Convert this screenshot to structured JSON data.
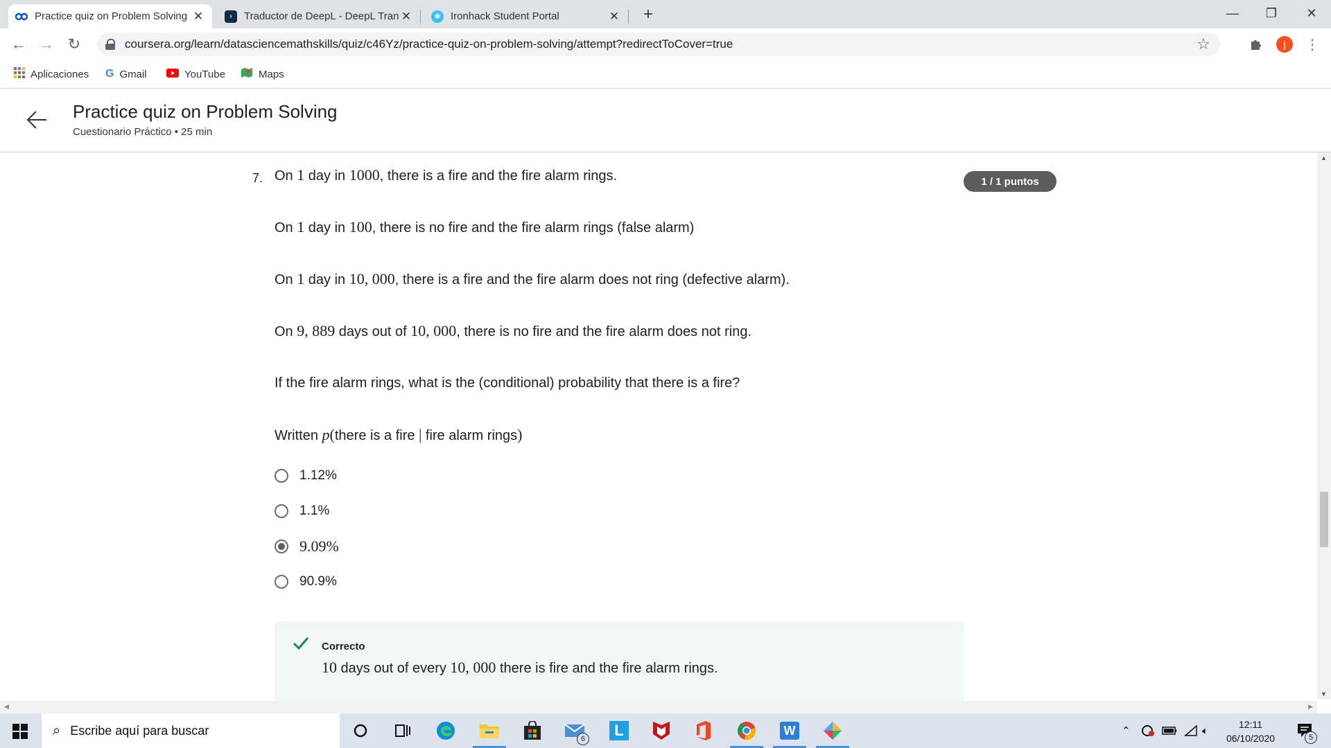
{
  "browser": {
    "tabs": [
      {
        "title": "Practice quiz on Problem Solving",
        "favicon": "coursera-icon",
        "active": true
      },
      {
        "title": "Traductor de DeepL - DeepL Tran",
        "favicon": "deepl-icon",
        "active": false
      },
      {
        "title": "Ironhack Student Portal",
        "favicon": "ironhack-icon",
        "active": false
      }
    ],
    "new_tab": "+",
    "url": "coursera.org/learn/datasciencemathskills/quiz/c46Yz/practice-quiz-on-problem-solving/attempt?redirectToCover=true",
    "profile_initial": "j",
    "bookmarks": [
      {
        "label": "Aplicaciones",
        "icon": "apps-grid-icon"
      },
      {
        "label": "Gmail",
        "icon": "google-icon"
      },
      {
        "label": "YouTube",
        "icon": "youtube-icon"
      },
      {
        "label": "Maps",
        "icon": "maps-icon"
      }
    ]
  },
  "quiz": {
    "title": "Practice quiz on Problem Solving",
    "subtitle": "Cuestionario Práctico • 25 min",
    "question_number": "7.",
    "score_badge": "1 / 1 puntos",
    "paragraphs": {
      "p1": {
        "a": "On ",
        "b": "1",
        "c": " day in ",
        "d": "1000",
        "e": ", there is a fire and the fire alarm rings."
      },
      "p2": {
        "a": "On ",
        "b": "1",
        "c": " day in ",
        "d": "100",
        "e": ", there is no fire and the fire alarm rings (false alarm)"
      },
      "p3": {
        "a": "On ",
        "b": "1",
        "c": " day in ",
        "d": "10, 000",
        "e": ", there is a fire and the fire alarm does not ring (defective alarm)."
      },
      "p4": {
        "a": "On ",
        "b": "9, 889",
        "c": " days out of ",
        "d": "10, 000",
        "e": ", there is no fire and the fire alarm does not ring."
      },
      "p5": {
        "a": "If the fire alarm rings, what is the (conditional) probability that there is a fire?"
      },
      "p6": {
        "a": "Written ",
        "b": "p",
        "c": "(",
        "d": "there is a fire",
        "e": " | ",
        "f": "fire alarm rings",
        "g": ")"
      }
    },
    "options": [
      {
        "label": "1.12%",
        "selected": false
      },
      {
        "label": "1.1%",
        "selected": false
      },
      {
        "label": "9.09%",
        "selected": true
      },
      {
        "label": "90.9%",
        "selected": false
      }
    ],
    "feedback": {
      "status": "Correcto",
      "a": "10",
      "b": " days out of every ",
      "c": "10, 000",
      "d": " there is fire and the fire alarm rings."
    }
  },
  "taskbar": {
    "search_placeholder": "Escribe aquí para buscar",
    "mail_badge": "6",
    "time": "12:11",
    "date": "06/10/2020",
    "notification_count": "5"
  },
  "colors": {
    "accent_badge": "#5c5c5c",
    "correct_green": "#1f8354",
    "feedback_bg": "#f0f7f5",
    "profile": "#f4511e"
  }
}
